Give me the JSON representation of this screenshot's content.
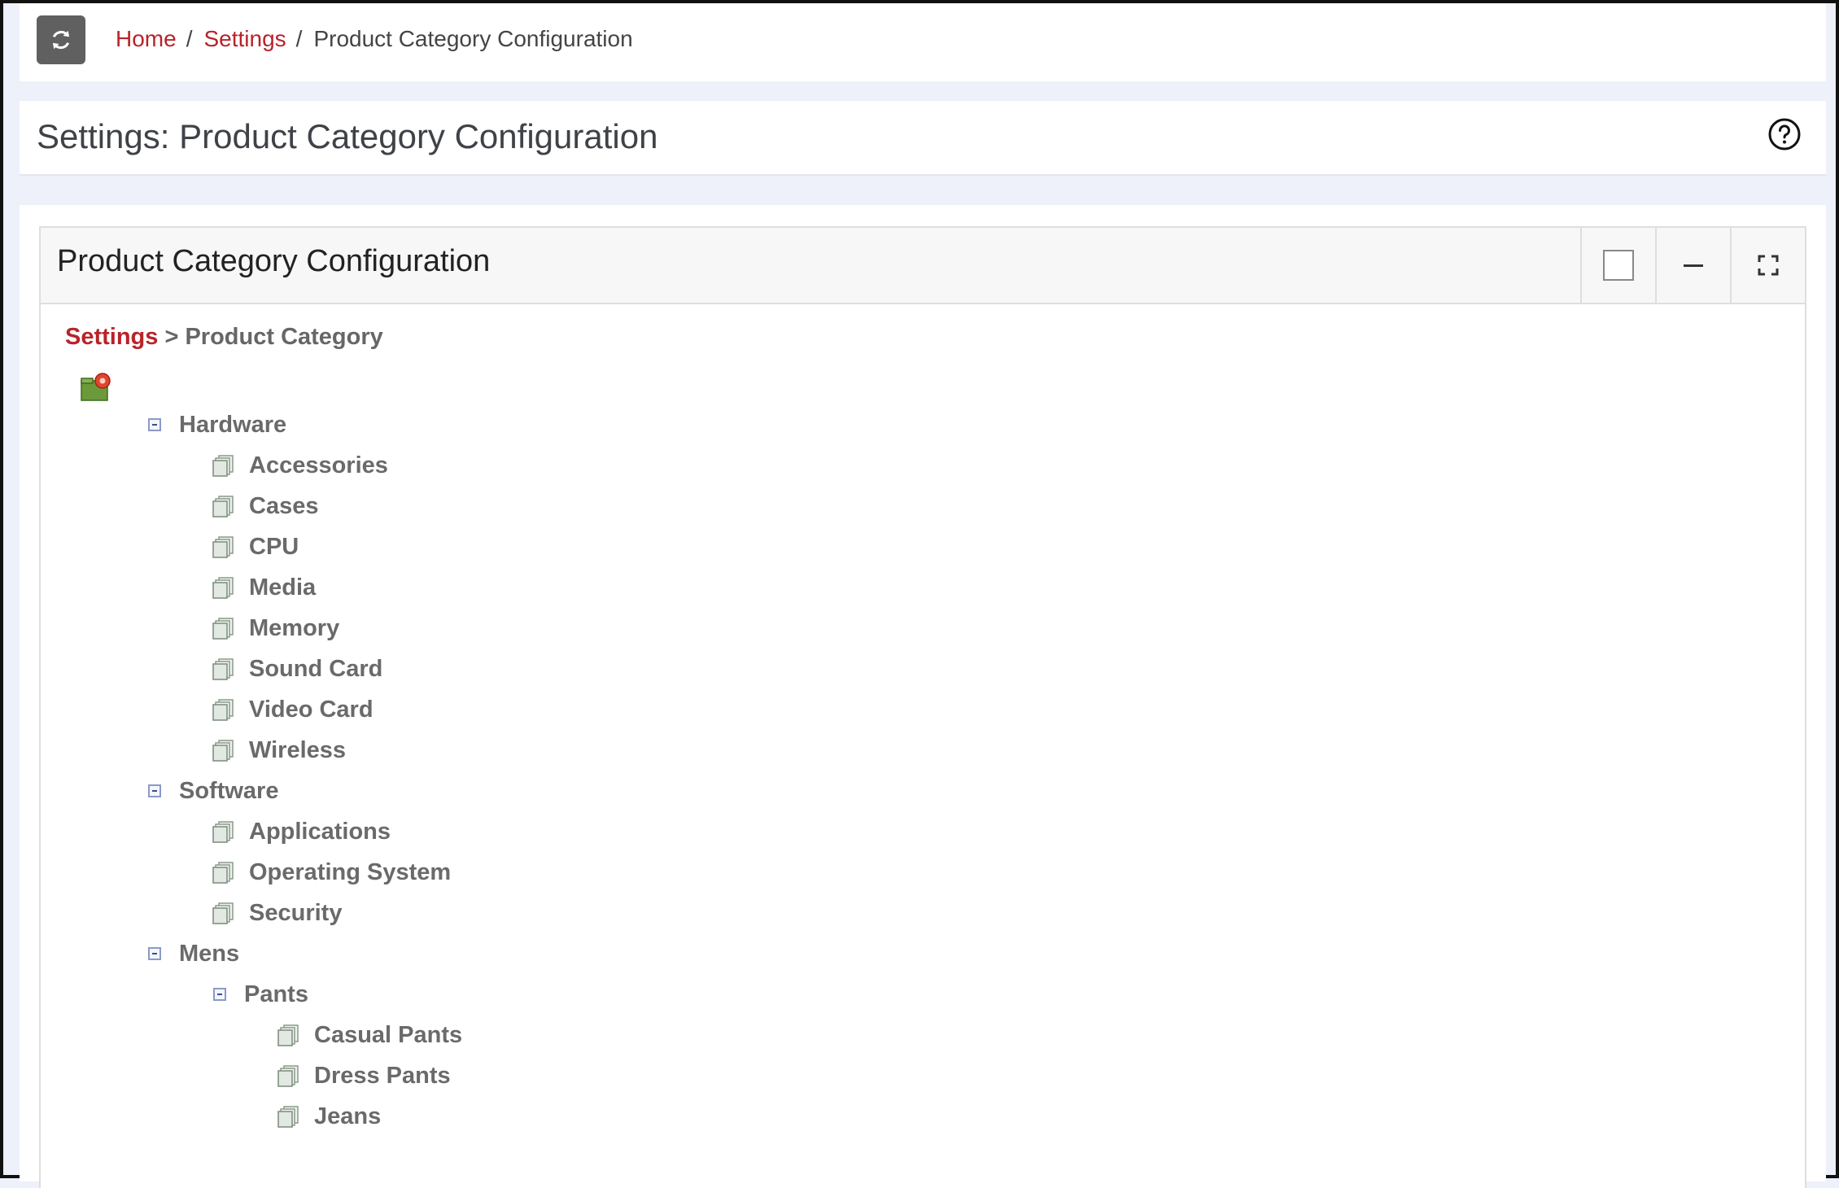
{
  "breadcrumb": {
    "home": "Home",
    "settings": "Settings",
    "current": "Product Category Configuration"
  },
  "header": {
    "title": "Settings: Product Category Configuration"
  },
  "panel": {
    "title": "Product Category Configuration",
    "sub_breadcrumb_link": "Settings",
    "sub_breadcrumb_rest": " > Product Category"
  },
  "tree": {
    "hardware": {
      "label": "Hardware",
      "children": [
        "Accessories",
        "Cases",
        "CPU",
        "Media",
        "Memory",
        "Sound Card",
        "Video Card",
        "Wireless"
      ]
    },
    "software": {
      "label": "Software",
      "children": [
        "Applications",
        "Operating System",
        "Security"
      ]
    },
    "mens": {
      "label": "Mens",
      "pants": {
        "label": "Pants",
        "children": [
          "Casual Pants",
          "Dress Pants",
          "Jeans"
        ]
      }
    }
  },
  "colors": {
    "link": "#b8232a",
    "tree_text": "#6a6a6a",
    "page_bg": "#eef0fa"
  }
}
